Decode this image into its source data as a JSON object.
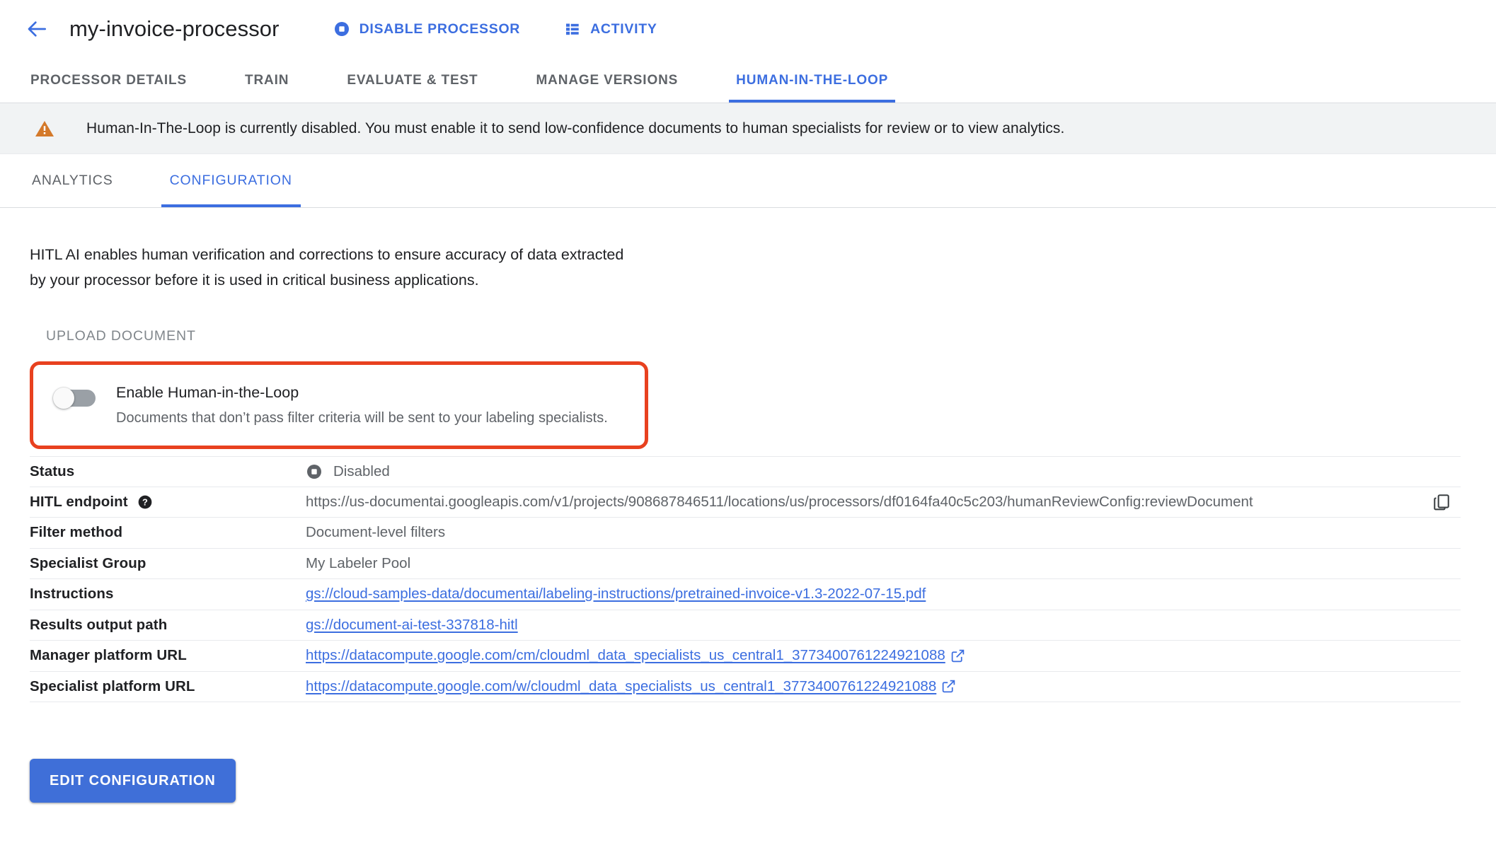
{
  "appbar": {
    "back_icon": "arrow-back-icon",
    "title": "my-invoice-processor",
    "actions": [
      {
        "label": "DISABLE PROCESSOR",
        "icon": "stop-circle-icon"
      },
      {
        "label": "ACTIVITY",
        "icon": "list-icon"
      }
    ]
  },
  "tabs": [
    {
      "label": "PROCESSOR DETAILS",
      "active": false
    },
    {
      "label": "TRAIN",
      "active": false
    },
    {
      "label": "EVALUATE & TEST",
      "active": false
    },
    {
      "label": "MANAGE VERSIONS",
      "active": false
    },
    {
      "label": "HUMAN-IN-THE-LOOP",
      "active": true
    }
  ],
  "banner": {
    "icon": "warning-triangle-icon",
    "text": "Human-In-The-Loop is currently disabled. You must enable it to send low-confidence documents to human specialists for review or to view analytics."
  },
  "subtabs": [
    {
      "label": "ANALYTICS",
      "active": false
    },
    {
      "label": "CONFIGURATION",
      "active": true
    }
  ],
  "main": {
    "intro_line1": "HITL AI enables human verification and corrections to ensure accuracy of data extracted",
    "intro_line2": "by your processor before it is used in critical business applications.",
    "upload_button": "UPLOAD DOCUMENT",
    "toggle": {
      "title": "Enable Human-in-the-Loop",
      "subtitle": "Documents that don’t pass filter criteria will be sent to your labeling specialists.",
      "state": "off",
      "highlight_color": "#e8411f"
    },
    "details": [
      {
        "label": "Status",
        "value": "Disabled",
        "type": "status",
        "icon": "stop-circle-icon",
        "help": false
      },
      {
        "label": "HITL endpoint",
        "value": "https://us-documentai.googleapis.com/v1/projects/908687846511/locations/us/processors/df0164fa40c5c203/humanReviewConfig:reviewDocument",
        "type": "endpoint",
        "help": true,
        "help_icon": "help-circle-icon",
        "copy_icon": "copy-icon"
      },
      {
        "label": "Filter method",
        "value": "Document-level filters",
        "type": "text",
        "help": false
      },
      {
        "label": "Specialist Group",
        "value": "My Labeler Pool",
        "type": "text",
        "help": false
      },
      {
        "label": "Instructions",
        "value": "gs://cloud-samples-data/documentai/labeling-instructions/pretrained-invoice-v1.3-2022-07-15.pdf",
        "type": "link",
        "external": false,
        "help": false
      },
      {
        "label": "Results output path",
        "value": "gs://document-ai-test-337818-hitl",
        "type": "link",
        "external": false,
        "help": false
      },
      {
        "label": "Manager platform URL",
        "value": "https://datacompute.google.com/cm/cloudml_data_specialists_us_central1_3773400761224921088",
        "type": "link",
        "external": true,
        "external_icon": "open-in-new-icon",
        "help": false
      },
      {
        "label": "Specialist platform URL",
        "value": "https://datacompute.google.com/w/cloudml_data_specialists_us_central1_3773400761224921088",
        "type": "link",
        "external": true,
        "external_icon": "open-in-new-icon",
        "help": false
      }
    ],
    "edit_button": "EDIT CONFIGURATION"
  },
  "colors": {
    "accent_blue": "#3c6ee0",
    "button_blue": "#3f6fd8",
    "warning_orange": "#d4792a",
    "highlight_red": "#e8411f",
    "text_primary": "#202124",
    "text_secondary": "#5f6368",
    "banner_bg": "#f1f3f4"
  }
}
